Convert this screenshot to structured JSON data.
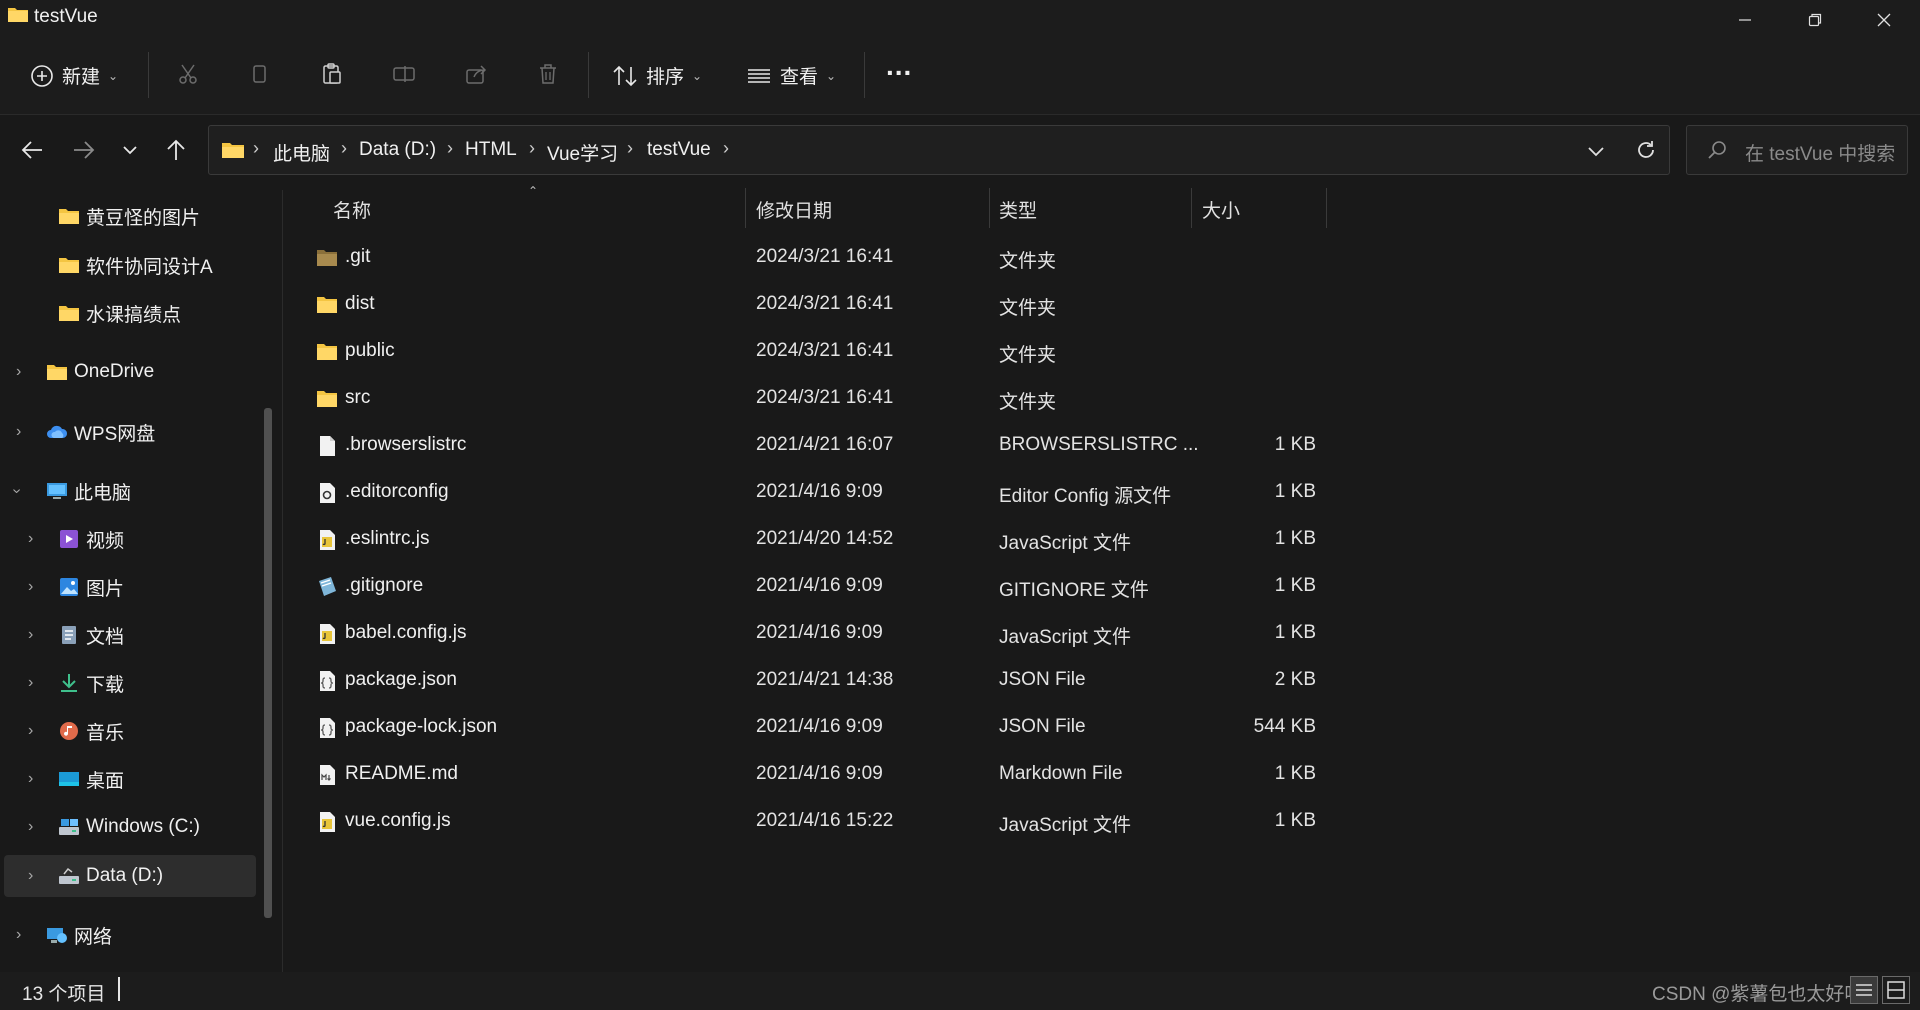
{
  "window": {
    "title": "testVue"
  },
  "toolbar": {
    "new_label": "新建",
    "sort_label": "排序",
    "view_label": "查看",
    "more_label": "..."
  },
  "address": {
    "crumbs": [
      "此电脑",
      "Data (D:)",
      "HTML",
      "Vue学习",
      "testVue"
    ],
    "search_placeholder": "在 testVue 中搜索"
  },
  "sidebar": {
    "items": [
      {
        "label": "黄豆怪的图片",
        "icon": "folder-icon"
      },
      {
        "label": "软件协同设计A",
        "icon": "folder-icon"
      },
      {
        "label": "水课搞绩点",
        "icon": "folder-icon"
      },
      {
        "label": "OneDrive",
        "icon": "folder-icon"
      },
      {
        "label": "WPS网盘",
        "icon": "cloud-icon"
      },
      {
        "label": "此电脑",
        "icon": "computer-icon"
      },
      {
        "label": "视频",
        "icon": "video-icon"
      },
      {
        "label": "图片",
        "icon": "pictures-icon"
      },
      {
        "label": "文档",
        "icon": "documents-icon"
      },
      {
        "label": "下载",
        "icon": "download-icon"
      },
      {
        "label": "音乐",
        "icon": "music-icon"
      },
      {
        "label": "桌面",
        "icon": "desktop-icon"
      },
      {
        "label": "Windows (C:)",
        "icon": "drive-icon"
      },
      {
        "label": "Data (D:)",
        "icon": "drive-icon"
      },
      {
        "label": "网络",
        "icon": "network-icon"
      }
    ]
  },
  "columns": {
    "name": "名称",
    "date": "修改日期",
    "type": "类型",
    "size": "大小"
  },
  "files": [
    {
      "name": ".git",
      "date": "2024/3/21 16:41",
      "type": "文件夹",
      "size": "",
      "icon": "folder-dark-icon"
    },
    {
      "name": "dist",
      "date": "2024/3/21 16:41",
      "type": "文件夹",
      "size": "",
      "icon": "folder-icon"
    },
    {
      "name": "public",
      "date": "2024/3/21 16:41",
      "type": "文件夹",
      "size": "",
      "icon": "folder-icon"
    },
    {
      "name": "src",
      "date": "2024/3/21 16:41",
      "type": "文件夹",
      "size": "",
      "icon": "folder-icon"
    },
    {
      "name": ".browserslistrc",
      "date": "2021/4/21 16:07",
      "type": "BROWSERSLISTRC ...",
      "size": "1 KB",
      "icon": "file-icon"
    },
    {
      "name": ".editorconfig",
      "date": "2021/4/16 9:09",
      "type": "Editor Config 源文件",
      "size": "1 KB",
      "icon": "config-file-icon"
    },
    {
      "name": ".eslintrc.js",
      "date": "2021/4/20 14:52",
      "type": "JavaScript 文件",
      "size": "1 KB",
      "icon": "js-file-icon"
    },
    {
      "name": ".gitignore",
      "date": "2021/4/16 9:09",
      "type": "GITIGNORE 文件",
      "size": "1 KB",
      "icon": "notepad-file-icon"
    },
    {
      "name": "babel.config.js",
      "date": "2021/4/16 9:09",
      "type": "JavaScript 文件",
      "size": "1 KB",
      "icon": "js-file-icon"
    },
    {
      "name": "package.json",
      "date": "2021/4/21 14:38",
      "type": "JSON File",
      "size": "2 KB",
      "icon": "json-file-icon"
    },
    {
      "name": "package-lock.json",
      "date": "2021/4/16 9:09",
      "type": "JSON File",
      "size": "544 KB",
      "icon": "json-file-icon"
    },
    {
      "name": "README.md",
      "date": "2021/4/16 9:09",
      "type": "Markdown File",
      "size": "1 KB",
      "icon": "markdown-file-icon"
    },
    {
      "name": "vue.config.js",
      "date": "2021/4/16 15:22",
      "type": "JavaScript 文件",
      "size": "1 KB",
      "icon": "js-file-icon"
    }
  ],
  "status": {
    "count": "13 个项目",
    "watermark": "CSDN @紫薯包也太好吃"
  },
  "colors": {
    "folder": "#f4c542",
    "accent": "#4aa3f0",
    "background": "#191919"
  }
}
